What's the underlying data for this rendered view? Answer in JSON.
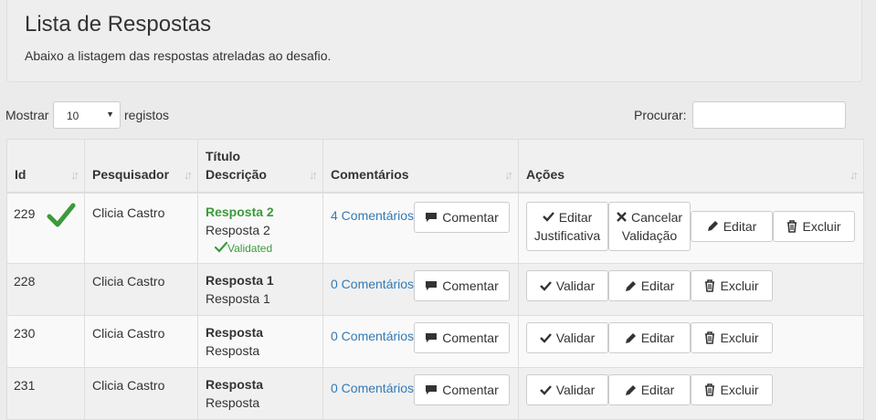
{
  "header": {
    "title": "Lista de Respostas",
    "subtitle": "Abaixo a listagem das respostas atreladas ao desafio."
  },
  "controls": {
    "show_label": "Mostrar",
    "page_size": "10",
    "records_label": "registos",
    "search_label": "Procurar:",
    "search_value": ""
  },
  "table": {
    "columns": {
      "id": "Id",
      "researcher": "Pesquisador",
      "title": "Título",
      "description": "Descrição",
      "comments": "Comentários",
      "actions": "Ações"
    },
    "rows": [
      {
        "id": "229",
        "validated": true,
        "researcher": "Clicia Castro",
        "title": "Resposta 2",
        "description": "Resposta 2",
        "validated_label": "Validated",
        "comments_link": "4 Comentários",
        "comment_btn": "Comentar",
        "actions": [
          "Editar Justificativa",
          "Cancelar Validação",
          "Editar",
          "Excluir"
        ]
      },
      {
        "id": "228",
        "validated": false,
        "researcher": "Clicia Castro",
        "title": "Resposta 1",
        "description": "Resposta 1",
        "comments_link": "0 Comentários",
        "comment_btn": "Comentar",
        "actions": [
          "Validar",
          "Editar",
          "Excluir"
        ]
      },
      {
        "id": "230",
        "validated": false,
        "researcher": "Clicia Castro",
        "title": "Resposta",
        "description": "Resposta",
        "comments_link": "0 Comentários",
        "comment_btn": "Comentar",
        "actions": [
          "Validar",
          "Editar",
          "Excluir"
        ]
      },
      {
        "id": "231",
        "validated": false,
        "researcher": "Clicia Castro",
        "title": "Resposta",
        "description": "Resposta",
        "comments_link": "0 Comentários",
        "comment_btn": "Comentar",
        "actions": [
          "Validar",
          "Editar",
          "Excluir"
        ]
      }
    ]
  },
  "colors": {
    "link": "#337ab7",
    "validated_green": "#3c9a3c"
  },
  "icons": {
    "validated": "check-icon",
    "comment": "comment-icon",
    "validate": "check-icon",
    "cancel": "x-icon",
    "edit": "pencil-icon",
    "delete": "trash-icon",
    "sort": "sort-icon"
  }
}
